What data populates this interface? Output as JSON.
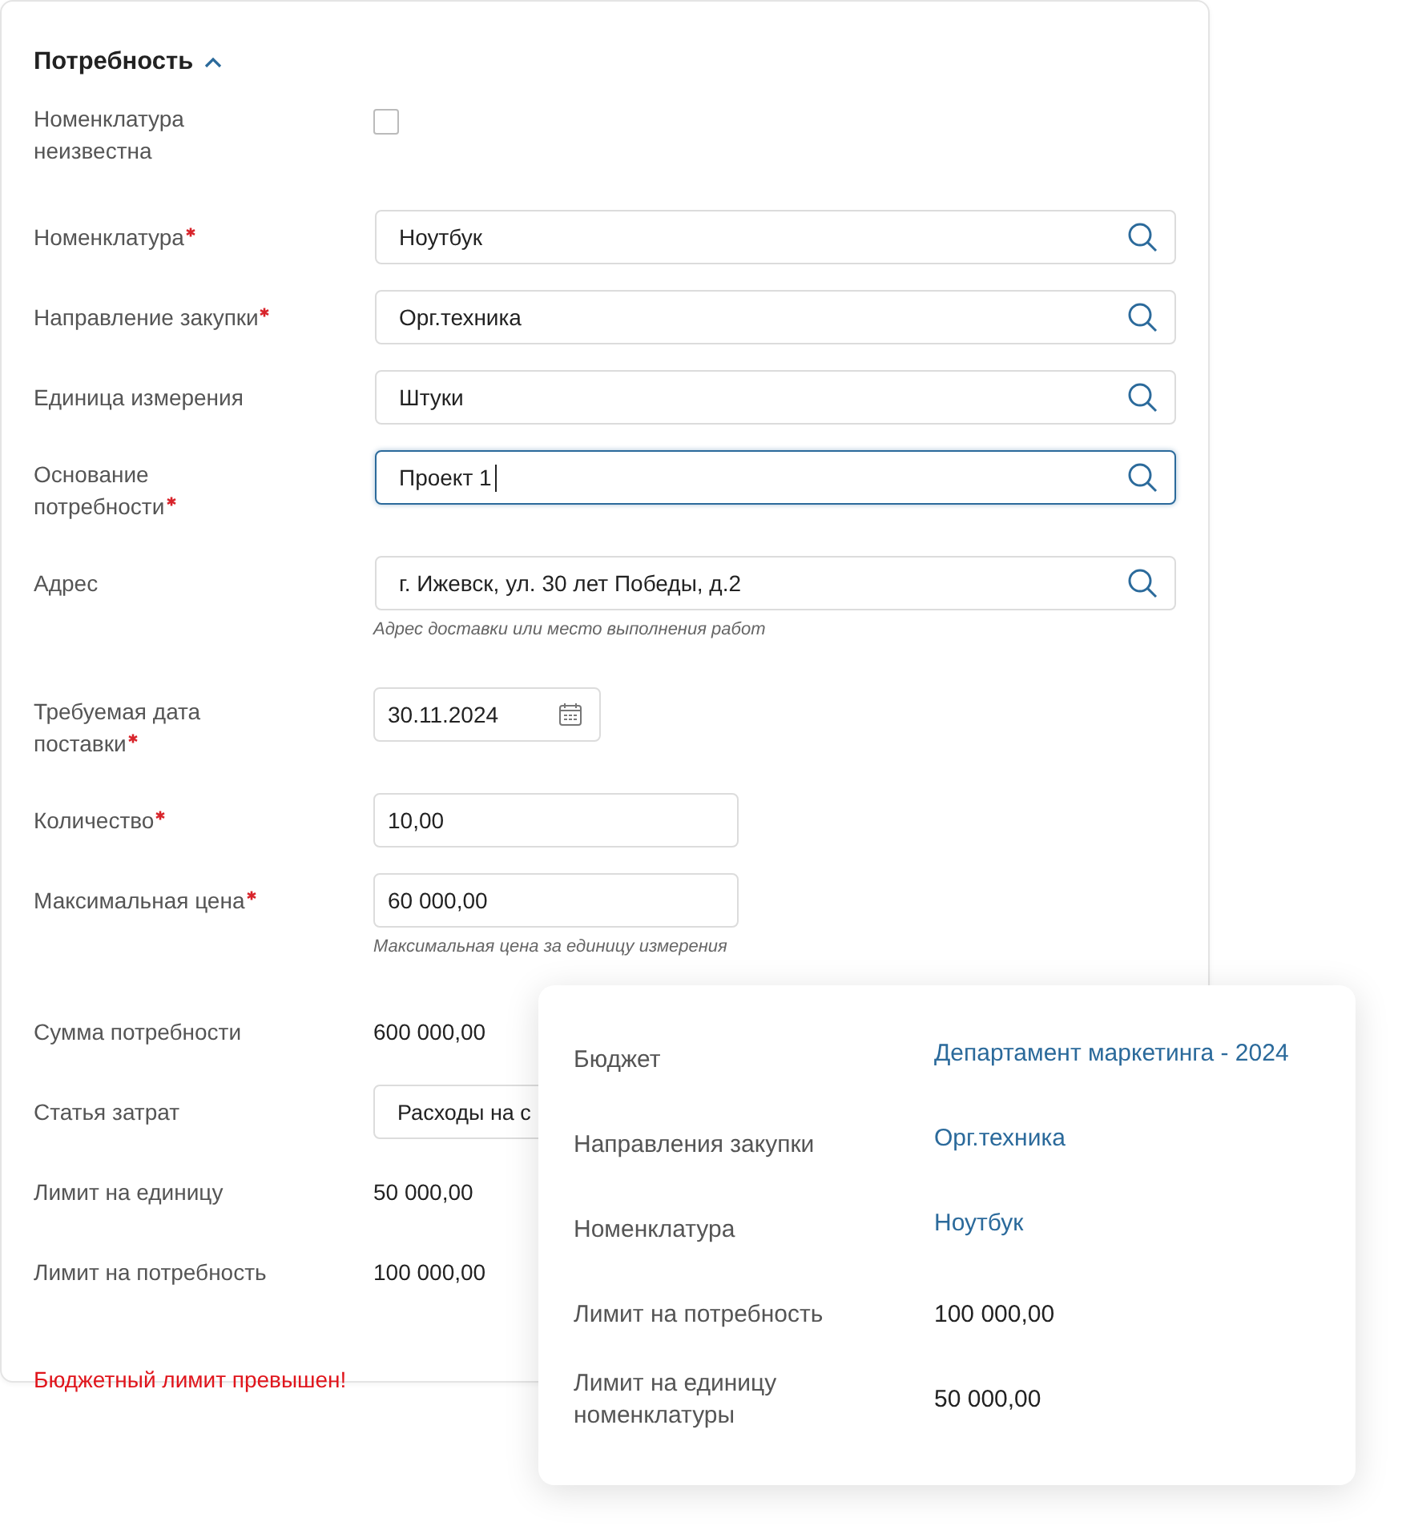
{
  "section": {
    "title": "Потребность",
    "expanded": true
  },
  "fields": [
    {
      "kind": "checkbox",
      "label": "Номенклатура неизвестна",
      "required": false,
      "checked": false
    },
    {
      "kind": "search",
      "label": "Номенклатура",
      "required": true,
      "value": "Ноутбук",
      "focused": false
    },
    {
      "kind": "search",
      "label": "Направление закупки",
      "required": true,
      "value": "Орг.техника",
      "focused": false
    },
    {
      "kind": "search",
      "label": "Единица измерения",
      "required": false,
      "value": "Штуки",
      "focused": false
    },
    {
      "kind": "search",
      "label": "Основание потребности",
      "required": true,
      "value": "Проект 1",
      "focused": true
    },
    {
      "kind": "search",
      "label": "Адрес",
      "required": false,
      "value": "г. Ижевск, ул. 30 лет Победы, д.2",
      "focused": false,
      "hint": "Адрес доставки или место выполнения работ"
    },
    {
      "kind": "date",
      "label": "Требуемая дата поставки",
      "required": true,
      "value": "30.11.2024"
    },
    {
      "kind": "input",
      "label": "Количество",
      "required": true,
      "value": "10,00"
    },
    {
      "kind": "input",
      "label": "Максимальная цена",
      "required": true,
      "value": "60 000,00",
      "hint": "Максимальная цена за единицу измерения"
    },
    {
      "kind": "text",
      "label": "Сумма потребности",
      "required": false,
      "value": "600 000,00"
    },
    {
      "kind": "select",
      "label": "Статья затрат",
      "required": false,
      "value": "Расходы на с"
    },
    {
      "kind": "text",
      "label": "Лимит на единицу",
      "required": false,
      "value": "50 000,00"
    },
    {
      "kind": "text",
      "label": "Лимит на потребность",
      "required": false,
      "value": "100 000,00"
    }
  ],
  "error": "Бюджетный лимит превышен!",
  "popup": {
    "rows": [
      {
        "label": "Бюджет",
        "value": "Департамент маркетинга - 2024",
        "link": true
      },
      {
        "label": "Направления закупки",
        "value": "Орг.техника",
        "link": true
      },
      {
        "label": "Номенклатура",
        "value": "Ноутбук",
        "link": true
      },
      {
        "label": "Лимит на потребность",
        "value": "100 000,00",
        "link": false
      },
      {
        "label": "Лимит на единицу номенклатуры",
        "value": "50 000,00",
        "link": false
      }
    ]
  }
}
